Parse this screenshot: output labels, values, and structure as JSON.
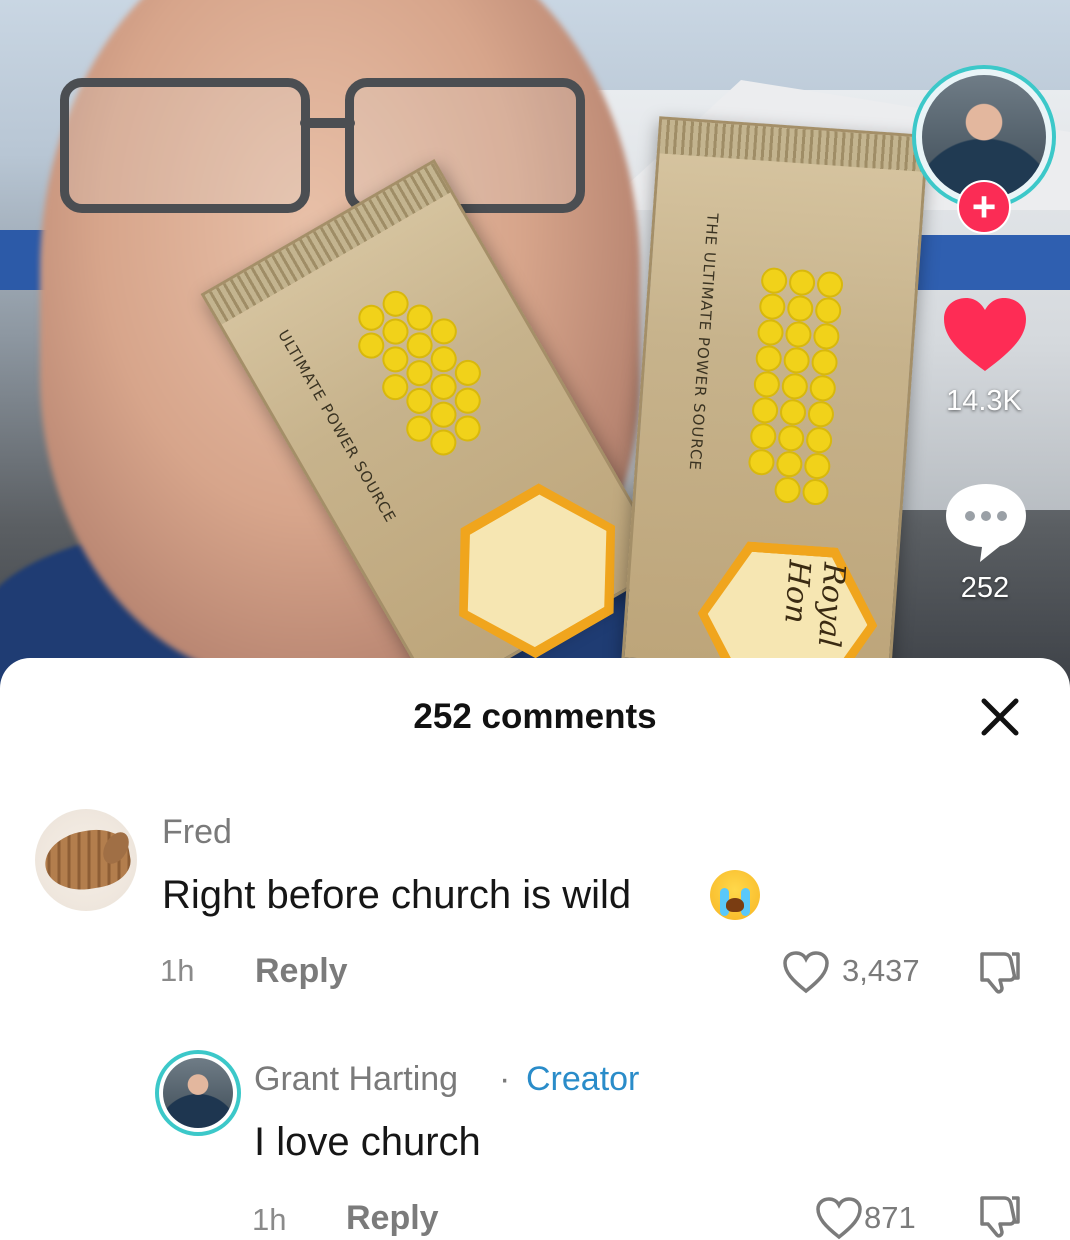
{
  "video": {
    "packet_left_text": "ULTIMATE POWER SOURCE",
    "packet_right_text": "THE ULTIMATE POWER SOURCE",
    "packet_brand": "Royal Hon"
  },
  "rail": {
    "follow_label": "+",
    "like_count": "14.3K",
    "comment_count": "252",
    "like_color": "#fe2c55",
    "avatar_ring_color": "#3cc8c9"
  },
  "sheet": {
    "title": "252 comments",
    "close_icon": "close-icon"
  },
  "comments": [
    {
      "username": "Fred",
      "text": "Right before church is wild",
      "emoji": "loudly-crying-face",
      "time": "1h",
      "reply_label": "Reply",
      "likes": "3,437"
    },
    {
      "username": "Grant Harting",
      "separator": "·",
      "creator_tag": "Creator",
      "text": "I love church",
      "time": "1h",
      "reply_label": "Reply",
      "likes": "871"
    }
  ]
}
